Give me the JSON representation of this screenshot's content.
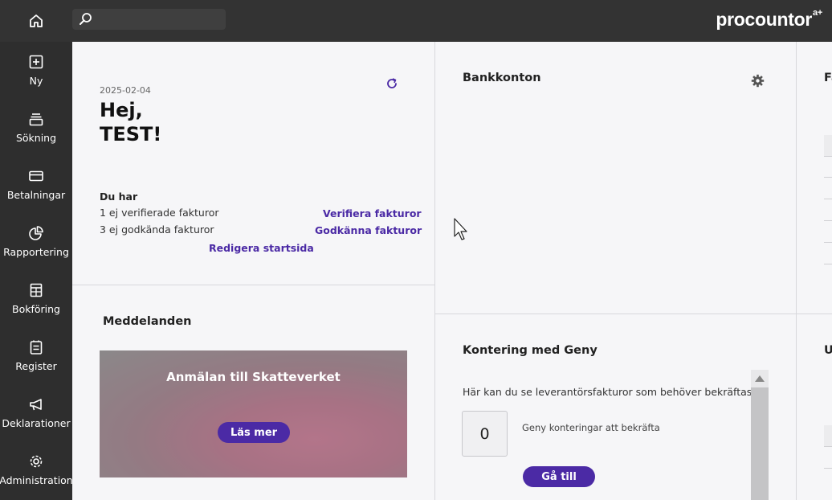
{
  "header": {
    "search_placeholder": "",
    "brand": "procountor",
    "brand_suffix": "a+"
  },
  "sidebar": {
    "items": [
      {
        "label": "Ny",
        "icon": "plus-square-icon"
      },
      {
        "label": "Sökning",
        "icon": "stack-icon"
      },
      {
        "label": "Betalningar",
        "icon": "card-icon"
      },
      {
        "label": "Rapportering",
        "icon": "pie-chart-icon"
      },
      {
        "label": "Bokföring",
        "icon": "calculator-icon"
      },
      {
        "label": "Register",
        "icon": "register-icon"
      },
      {
        "label": "Deklarationer",
        "icon": "megaphone-icon"
      },
      {
        "label": "Administration",
        "icon": "gear-icon"
      }
    ]
  },
  "welcome": {
    "date": "2025-02-04",
    "greeting_line1": "Hej,",
    "greeting_line2": "TEST!",
    "du_har": "Du har",
    "unverified": "1 ej verifierade fakturor",
    "unapproved": "3 ej godkända fakturor",
    "verify_link": "Verifiera fakturor",
    "approve_link": "Godkänna fakturor",
    "edit_link": "Redigera startsida"
  },
  "messages": {
    "title": "Meddelanden",
    "banner_title": "Anmälan till Skatteverket",
    "banner_button": "Läs mer"
  },
  "bank": {
    "title": "Bankkonton"
  },
  "geny": {
    "title": "Kontering med Geny",
    "description": "Här kan du se leverantörsfakturor som behöver bekräftas.",
    "count": "0",
    "count_label": "Geny konteringar att bekräfta",
    "goto_button": "Gå till"
  },
  "right_col": {
    "title_top": "Fa",
    "title_bottom": "U"
  }
}
